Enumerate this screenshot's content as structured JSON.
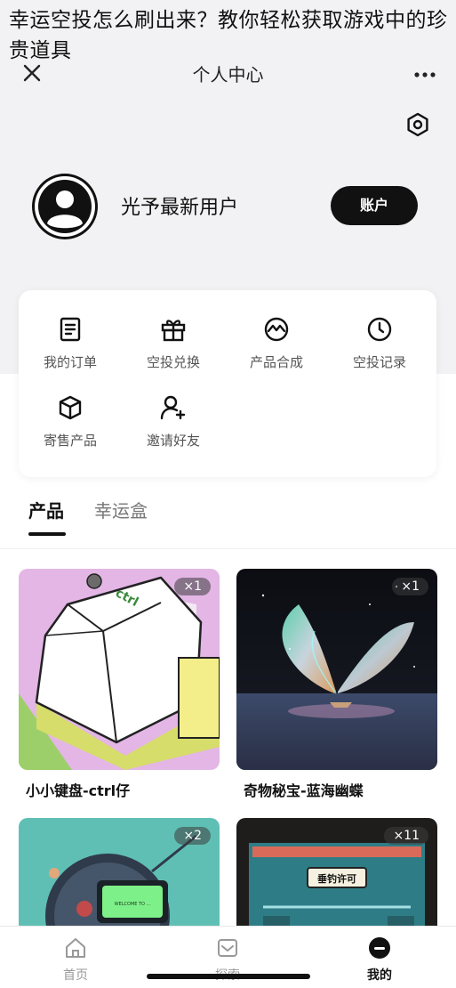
{
  "overlay": {
    "title": "幸运空投怎么刷出来？教你轻松获取游戏中的珍贵道具"
  },
  "navbar": {
    "title": "个人中心"
  },
  "profile": {
    "username": "光予最新用户",
    "account_label": "账户"
  },
  "menu": {
    "items": [
      {
        "label": "我的订单",
        "icon": "order-icon"
      },
      {
        "label": "空投兑换",
        "icon": "gift-icon"
      },
      {
        "label": "产品合成",
        "icon": "synthesis-icon"
      },
      {
        "label": "空投记录",
        "icon": "clock-icon"
      },
      {
        "label": "寄售产品",
        "icon": "box-icon"
      },
      {
        "label": "邀请好友",
        "icon": "add-user-icon"
      }
    ]
  },
  "tabs": [
    {
      "label": "产品",
      "active": true
    },
    {
      "label": "幸运盒",
      "active": false
    }
  ],
  "products": [
    {
      "name": "小小键盘-ctrl仔",
      "qty": "×1",
      "key_label": "ctrl"
    },
    {
      "name": "奇物秘宝-蓝海幽蝶",
      "qty": "×1"
    },
    {
      "name": "",
      "qty": "×2",
      "screen_text": "WELCOME TO ..."
    },
    {
      "name": "",
      "qty": "×11",
      "sign_text": "垂钓许可"
    }
  ],
  "bottom_nav": [
    {
      "label": "首页",
      "icon": "home-icon",
      "active": false
    },
    {
      "label": "探索",
      "icon": "explore-icon",
      "active": false
    },
    {
      "label": "我的",
      "icon": "profile-icon",
      "active": true
    }
  ],
  "colors": {
    "primary": "#111111",
    "header_bg": "#f2f2f4",
    "muted_text": "#777777"
  }
}
